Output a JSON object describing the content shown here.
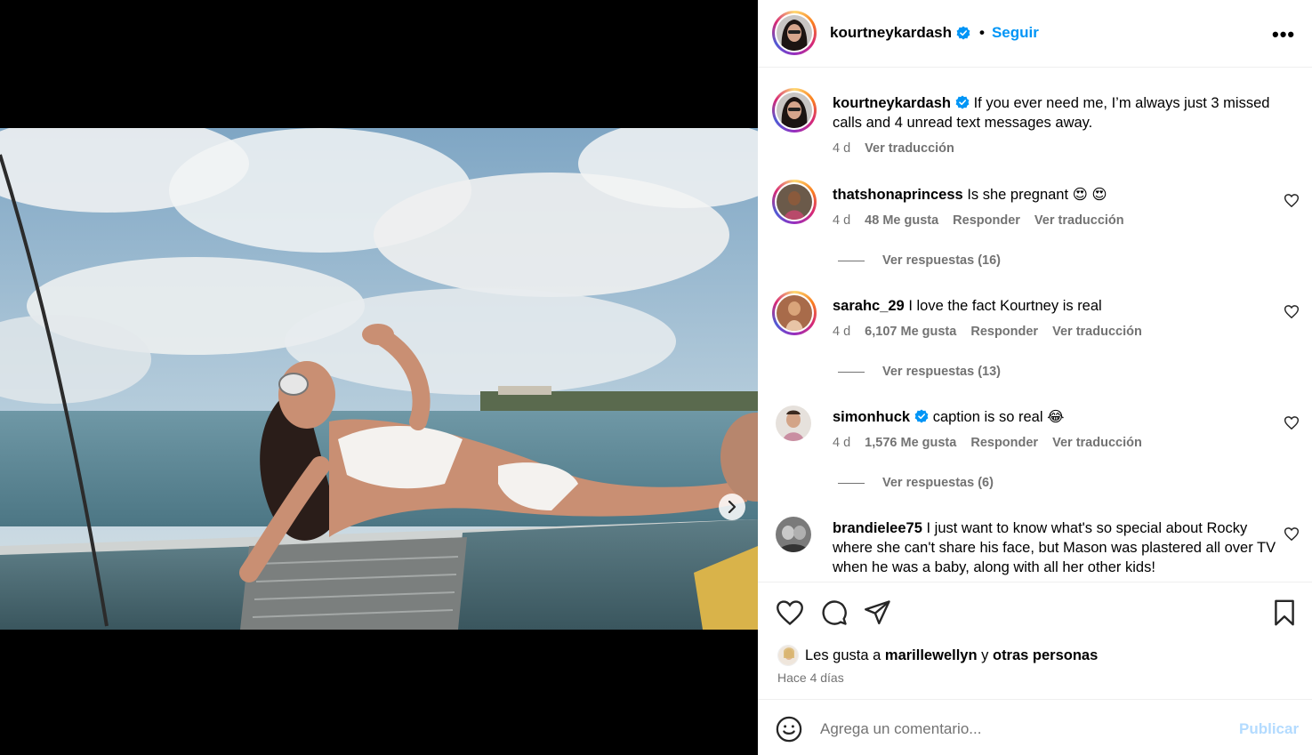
{
  "post": {
    "username": "kourtneykardash",
    "verified": true,
    "follow_label": "Seguir",
    "more_label": "•••",
    "carousel_dots": 12,
    "active_dot": 0
  },
  "caption": {
    "username": "kourtneykardash",
    "text": "If you ever need me, I’m always just 3 missed calls and 4 unread text messages away.",
    "time": "4 d",
    "translate": "Ver traducción"
  },
  "comments": [
    {
      "username": "thatshonaprincess",
      "verified": false,
      "text": "Is she pregnant 😍 😍",
      "time": "4 d",
      "likes": "48 Me gusta",
      "reply": "Responder",
      "translate": "Ver traducción",
      "replies": "Ver respuestas (16)"
    },
    {
      "username": "sarahc_29",
      "verified": false,
      "text": "I love the fact Kourtney is real",
      "time": "4 d",
      "likes": "6,107 Me gusta",
      "reply": "Responder",
      "translate": "Ver traducción",
      "replies": "Ver respuestas (13)"
    },
    {
      "username": "simonhuck",
      "verified": true,
      "text": "caption is so real 😂",
      "time": "4 d",
      "likes": "1,576 Me gusta",
      "reply": "Responder",
      "translate": "Ver traducción",
      "replies": "Ver respuestas (6)"
    },
    {
      "username": "brandielee75",
      "verified": false,
      "text": "I just want to know what's so special about Rocky where she can't share his face, but Mason was plastered all over TV when he was a baby, along with all her other kids!"
    }
  ],
  "likes_line": {
    "prefix": "Les gusta a",
    "user": "marillewellyn",
    "joiner": "y",
    "others": "otras personas"
  },
  "posted": "Hace 4 días",
  "comment_box": {
    "placeholder": "Agrega un comentario...",
    "value": "",
    "publish_label": "Publicar"
  },
  "colors": {
    "accent": "#0095f6",
    "muted": "#737373",
    "publish_disabled": "#b3dbff",
    "verified": "#0095f6"
  }
}
